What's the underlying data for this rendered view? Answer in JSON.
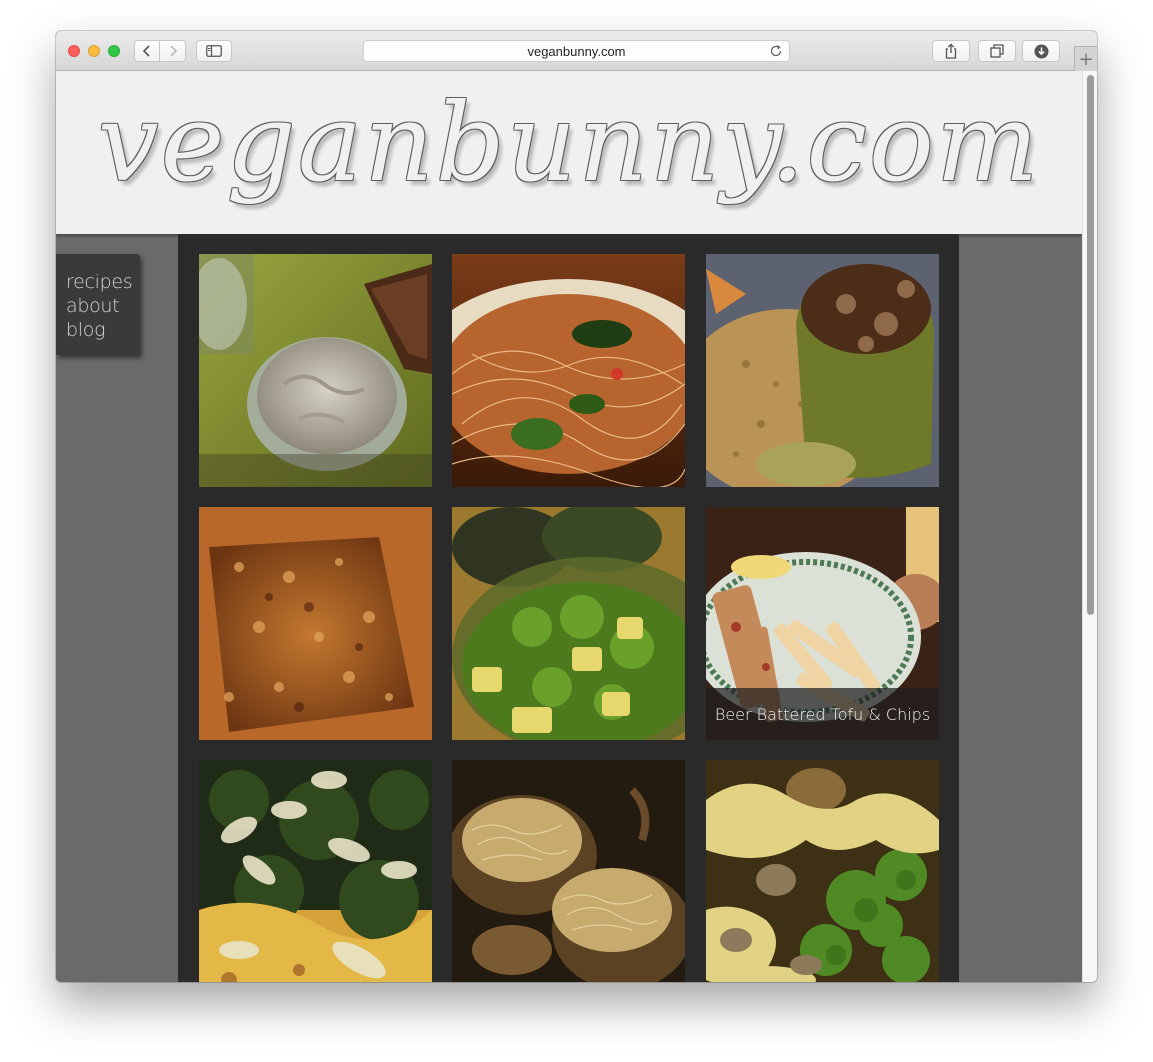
{
  "browser": {
    "url": "veganbunny.com",
    "new_tab_label": "+"
  },
  "site": {
    "logo": "veganbunny.com",
    "menu": [
      "recipes",
      "about",
      "blog"
    ]
  },
  "gallery": {
    "tiles": [
      {
        "name": "tile-creamy-dip",
        "caption": ""
      },
      {
        "name": "tile-noodles",
        "caption": ""
      },
      {
        "name": "tile-stuffed-pepper",
        "caption": ""
      },
      {
        "name": "tile-crusted-tofu",
        "caption": ""
      },
      {
        "name": "tile-kale-avocado-salad",
        "caption": ""
      },
      {
        "name": "tile-beer-battered-tofu",
        "caption": "Beer Battered Tofu & Chips"
      },
      {
        "name": "tile-kale-frittata",
        "caption": ""
      },
      {
        "name": "tile-stuffed-onions",
        "caption": ""
      },
      {
        "name": "tile-broccoli-sauce",
        "caption": ""
      }
    ]
  },
  "colors": {
    "page_background": "#6a6a6a",
    "gallery_background": "#2a2a2a",
    "header_background": "#f0f0f0",
    "menu_background": "#3a3a3a"
  }
}
